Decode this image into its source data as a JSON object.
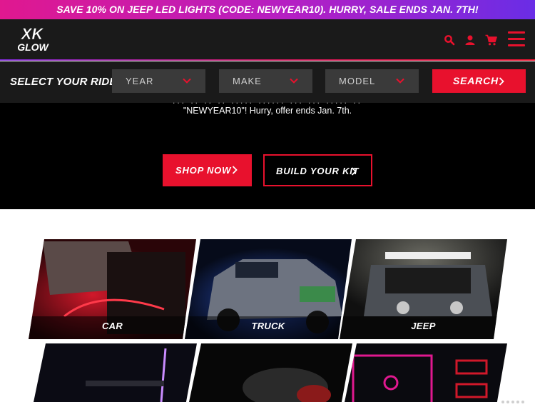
{
  "promo": {
    "text": "SAVE 10% ON JEEP LED LIGHTS (CODE: NEWYEAR10). HURRY, SALE ENDS JAN. 7TH!"
  },
  "brand": {
    "logo_line1": "XK",
    "logo_line2": "GLOW",
    "accent": "#e8112d"
  },
  "header_icons": [
    "search-icon",
    "account-icon",
    "cart-icon",
    "menu-icon"
  ],
  "ride_selector": {
    "label": "SELECT YOUR RIDE:",
    "year": "YEAR",
    "make": "MAKE",
    "model": "MODEL",
    "search": "SEARCH"
  },
  "hero": {
    "partial_text": "... .. .. .. ..... ...... ... ... ..... ..",
    "text": "\"NEWYEAR10\"! Hurry, offer ends Jan. 7th.",
    "shop_now": "SHOP NOW",
    "build_kit": "BUILD YOUR KIT"
  },
  "categories": [
    {
      "label": "CAR"
    },
    {
      "label": "TRUCK"
    },
    {
      "label": "JEEP"
    }
  ]
}
